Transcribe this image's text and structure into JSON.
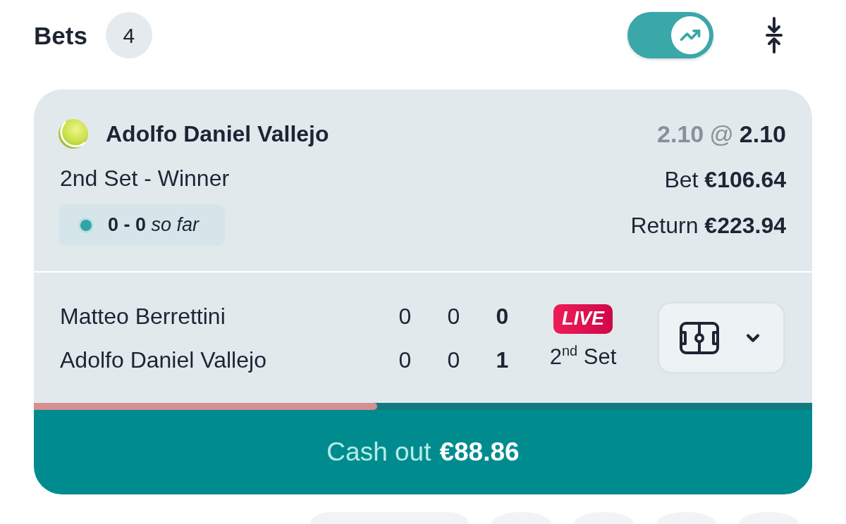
{
  "header": {
    "title": "Bets",
    "count": "4",
    "toggle": {
      "on": true
    }
  },
  "bet": {
    "selection": "Adolfo Daniel Vallejo",
    "market": "2nd Set - Winner",
    "live_score": "**0 - 0** *so far*",
    "odds": {
      "original": "2.10",
      "at": "@",
      "current": "2.10"
    },
    "stake_line": "Bet **€106.64**",
    "return_line": "Return **€223.94**"
  },
  "match": {
    "players": [
      {
        "name": "Matteo Berrettini",
        "scores": [
          "0",
          "0",
          "0"
        ]
      },
      {
        "name": "Adolfo Daniel Vallejo",
        "scores": [
          "0",
          "0",
          "1"
        ]
      }
    ],
    "live_badge": "LIVE",
    "period": "2$^{nd}$ Set",
    "expanded": false
  },
  "cash_out": {
    "level": 0.441,
    "label": "Cash out",
    "amount": "€88.86"
  },
  "bottom_chips": [
    {
      "kind": "wide"
    },
    {
      "kind": "round"
    },
    {
      "kind": "round"
    },
    {
      "kind": "round"
    },
    {
      "kind": "round"
    }
  ]
}
